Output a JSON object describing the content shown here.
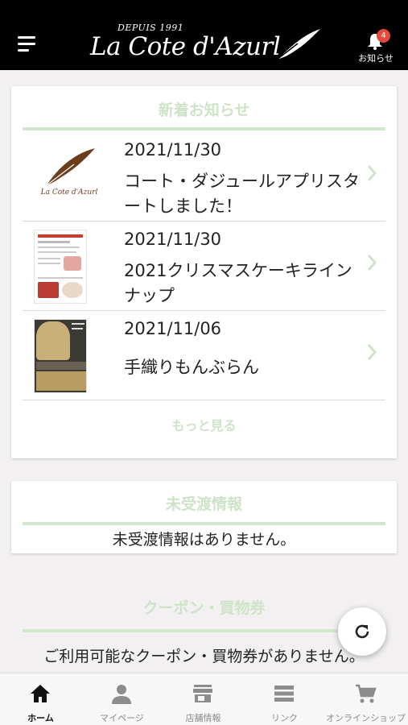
{
  "header": {
    "logo_small": "DEPUIS 1991",
    "logo_main": "La Cote d'Azurl",
    "notice_badge": "4",
    "notice_label": "お知らせ",
    "icons": [
      "menu-icon",
      "bell-icon",
      "feather-icon"
    ]
  },
  "news": {
    "title": "新着お知らせ",
    "items": [
      {
        "date": "2021/11/30",
        "title": "コート・ダジュールアプリスタートしました！",
        "thumb": "logo-thumbnail"
      },
      {
        "date": "2021/11/30",
        "title": "2021クリスマスケーキラインナップ",
        "thumb": "christmas-flyer-thumbnail"
      },
      {
        "date": "2021/11/06",
        "title": "手織りもんぶらん",
        "thumb": "mont-blanc-thumbnail"
      }
    ],
    "thumb_caption": "La Cote d'Azurl",
    "more": "もっと見る"
  },
  "undelivered": {
    "title": "未受渡情報",
    "empty": "未受渡情報はありません。"
  },
  "coupon": {
    "title": "クーポン・買物券",
    "empty": "ご利用可能なクーポン・買物券がありません。"
  },
  "tabs": [
    {
      "label": "ホーム",
      "icon": "home-icon",
      "active": true
    },
    {
      "label": "マイページ",
      "icon": "person-icon",
      "active": false
    },
    {
      "label": "店舗情報",
      "icon": "store-icon",
      "active": false
    },
    {
      "label": "リンク",
      "icon": "list-icon",
      "active": false
    },
    {
      "label": "オンラインショップ",
      "icon": "cart-icon",
      "active": false
    }
  ],
  "colors": {
    "header_bg": "#000000",
    "accent_green": "#cfe3c9",
    "badge_red": "#e24a3c",
    "page_bg": "#f2f0f1"
  }
}
